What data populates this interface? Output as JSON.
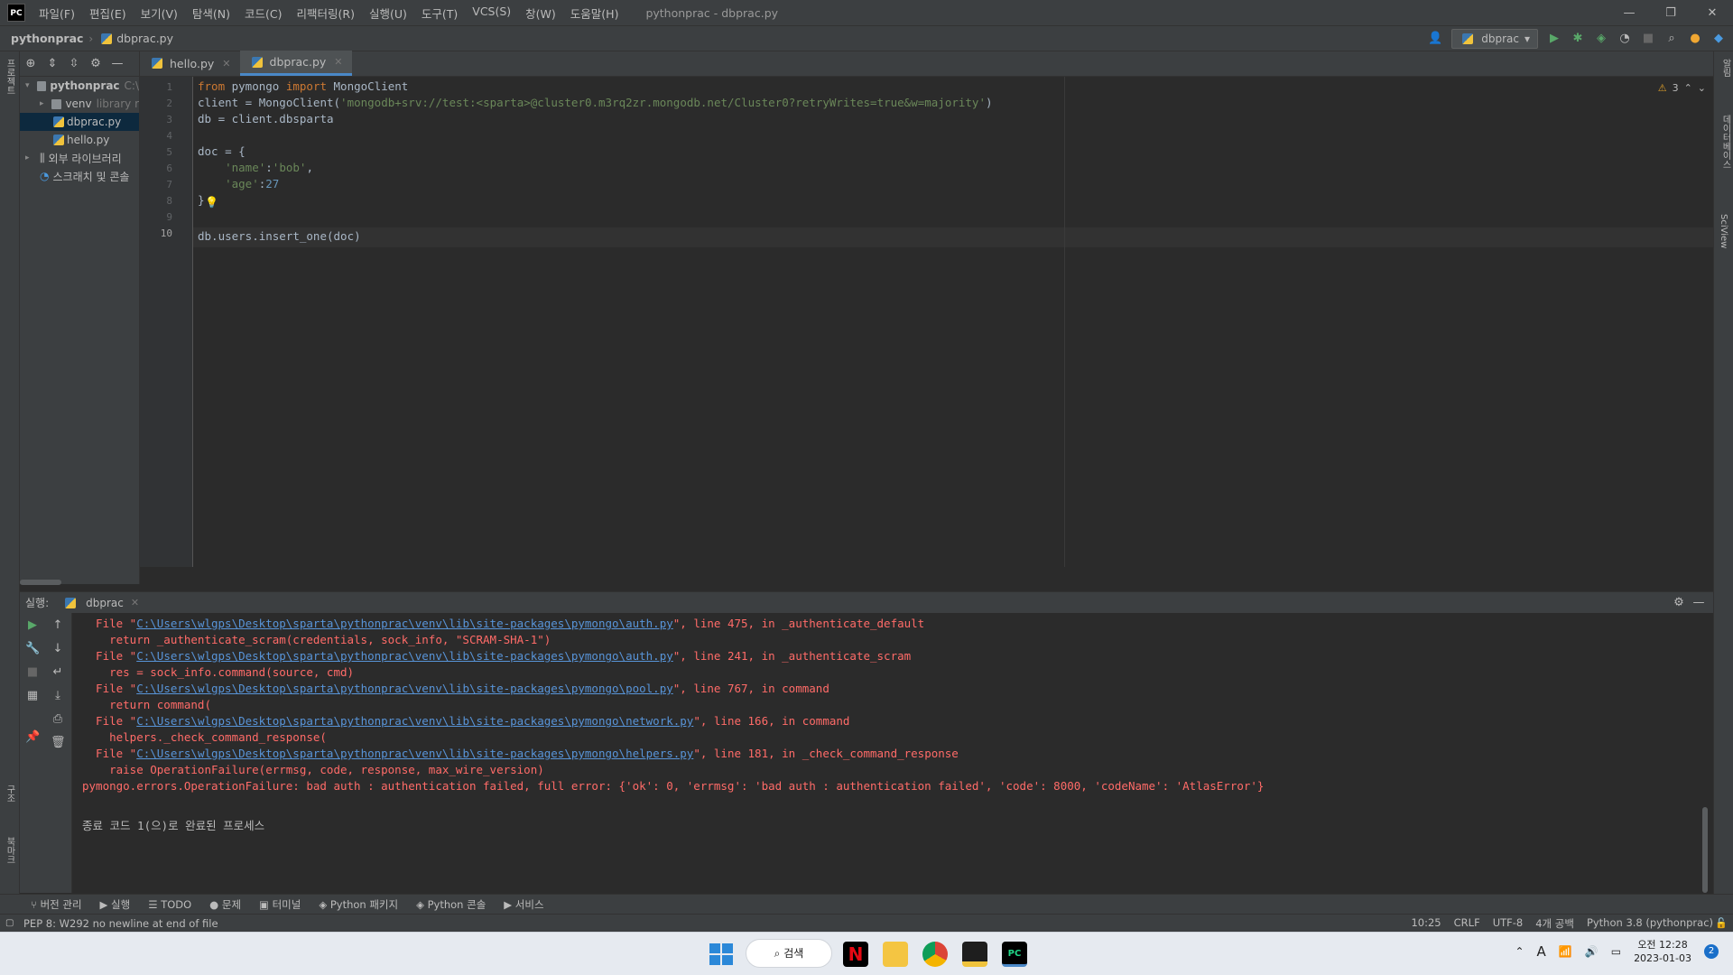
{
  "titlebar": {
    "logo": "PC",
    "menu": [
      "파일(F)",
      "편집(E)",
      "보기(V)",
      "탐색(N)",
      "코드(C)",
      "리팩터링(R)",
      "실행(U)",
      "도구(T)",
      "VCS(S)",
      "창(W)",
      "도움말(H)"
    ],
    "title": "pythonprac - dbprac.py"
  },
  "navbar": {
    "project": "pythonprac",
    "file": "dbprac.py",
    "run_config": "dbprac"
  },
  "leftstrip": {
    "project_label": "프로젝트",
    "structure_label": "구조",
    "bookmarks_label": "북마크"
  },
  "rightstrip": {
    "notifications": "알림",
    "database": "데이터베이스",
    "sciview": "SciView"
  },
  "project_tree": [
    {
      "label": "pythonprac",
      "extra": "C:\\",
      "depth": 0,
      "kind": "folder",
      "expanded": true
    },
    {
      "label": "venv",
      "extra": "library r",
      "depth": 1,
      "kind": "folder",
      "expanded": false
    },
    {
      "label": "dbprac.py",
      "extra": "",
      "depth": 1,
      "kind": "py",
      "selected": true
    },
    {
      "label": "hello.py",
      "extra": "",
      "depth": 1,
      "kind": "py"
    },
    {
      "label": "외부 라이브러리",
      "extra": "",
      "depth": 0,
      "kind": "lib"
    },
    {
      "label": "스크래치 및 콘솔",
      "extra": "",
      "depth": 0,
      "kind": "scratch"
    }
  ],
  "tabs": [
    {
      "label": "hello.py",
      "active": false
    },
    {
      "label": "dbprac.py",
      "active": true
    }
  ],
  "editor": {
    "warnings": "3",
    "lines": [
      {
        "n": "1",
        "html": "<span class='kw'>from</span> pymongo <span class='kw'>import</span> MongoClient"
      },
      {
        "n": "2",
        "html": "client = MongoClient(<span class='str'>'mongodb+srv://test:&lt;sparta&gt;@cluster0.m3rq2zr.mongodb.net/Cluster0?retryWrites=true&amp;w=majority'</span>)"
      },
      {
        "n": "3",
        "html": "db = client.dbsparta"
      },
      {
        "n": "4",
        "html": ""
      },
      {
        "n": "5",
        "html": "doc = {"
      },
      {
        "n": "6",
        "html": "    <span class='str'>'name'</span>:<span class='str'>'bob'</span>,"
      },
      {
        "n": "7",
        "html": "    <span class='str'>'age'</span>:<span class='num'>27</span>"
      },
      {
        "n": "8",
        "html": "}"
      },
      {
        "n": "9",
        "html": ""
      },
      {
        "n": "10",
        "html": "db.users.insert_one(doc)"
      }
    ]
  },
  "run": {
    "label": "실행:",
    "config": "dbprac",
    "console": [
      {
        "kind": "file",
        "prefix": "  File \"",
        "link": "C:\\Users\\wlgps\\Desktop\\sparta\\pythonprac\\venv\\lib\\site-packages\\pymongo\\auth.py",
        "suffix": "\", line 475, in _authenticate_default"
      },
      {
        "kind": "text",
        "text": "    return _authenticate_scram(credentials, sock_info, \"SCRAM-SHA-1\")"
      },
      {
        "kind": "file",
        "prefix": "  File \"",
        "link": "C:\\Users\\wlgps\\Desktop\\sparta\\pythonprac\\venv\\lib\\site-packages\\pymongo\\auth.py",
        "suffix": "\", line 241, in _authenticate_scram"
      },
      {
        "kind": "text",
        "text": "    res = sock_info.command(source, cmd)"
      },
      {
        "kind": "file",
        "prefix": "  File \"",
        "link": "C:\\Users\\wlgps\\Desktop\\sparta\\pythonprac\\venv\\lib\\site-packages\\pymongo\\pool.py",
        "suffix": "\", line 767, in command"
      },
      {
        "kind": "text",
        "text": "    return command("
      },
      {
        "kind": "file",
        "prefix": "  File \"",
        "link": "C:\\Users\\wlgps\\Desktop\\sparta\\pythonprac\\venv\\lib\\site-packages\\pymongo\\network.py",
        "suffix": "\", line 166, in command"
      },
      {
        "kind": "text",
        "text": "    helpers._check_command_response("
      },
      {
        "kind": "file",
        "prefix": "  File \"",
        "link": "C:\\Users\\wlgps\\Desktop\\sparta\\pythonprac\\venv\\lib\\site-packages\\pymongo\\helpers.py",
        "suffix": "\", line 181, in _check_command_response"
      },
      {
        "kind": "text",
        "text": "    raise OperationFailure(errmsg, code, response, max_wire_version)"
      },
      {
        "kind": "text",
        "text": "pymongo.errors.OperationFailure: bad auth : authentication failed, full error: {'ok': 0, 'errmsg': 'bad auth : authentication failed', 'code': 8000, 'codeName': 'AtlasError'}"
      },
      {
        "kind": "blank",
        "text": ""
      },
      {
        "kind": "plain",
        "text": "종료 코드 1(으)로 완료된 프로세스"
      }
    ]
  },
  "bottom_tabs": [
    "버전 관리",
    "실행",
    "TODO",
    "문제",
    "터미널",
    "Python 패키지",
    "Python 콘솔",
    "서비스"
  ],
  "status": {
    "message": "PEP 8: W292 no newline at end of file",
    "position": "10:25",
    "line_sep": "CRLF",
    "encoding": "UTF-8",
    "indent": "4개 공백",
    "interpreter": "Python 3.8 (pythonprac)"
  },
  "taskbar": {
    "search": "검색",
    "time": "오전 12:28",
    "date": "2023-01-03",
    "notif_count": "2",
    "ime": "A"
  }
}
